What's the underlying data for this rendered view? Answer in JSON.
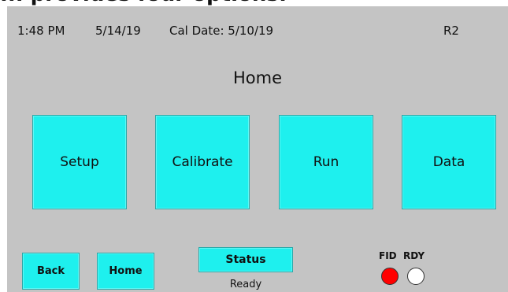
{
  "caption": {
    "text": "... provides four options:"
  },
  "status_bar": {
    "time": "1:48 PM",
    "date": "5/14/19",
    "cal_date": "Cal Date: 5/10/19",
    "revision": "R2"
  },
  "page": {
    "title": "Home"
  },
  "main_buttons": [
    {
      "label": "Setup"
    },
    {
      "label": "Calibrate"
    },
    {
      "label": "Run"
    },
    {
      "label": "Data"
    }
  ],
  "nav": {
    "back_label": "Back",
    "home_label": "Home",
    "status_label": "Status",
    "status_value": "Ready"
  },
  "indicators": {
    "fid_label": "FID",
    "rdy_label": "RDY",
    "fid_color": "#ff0000",
    "rdy_color": "#ffffff"
  }
}
